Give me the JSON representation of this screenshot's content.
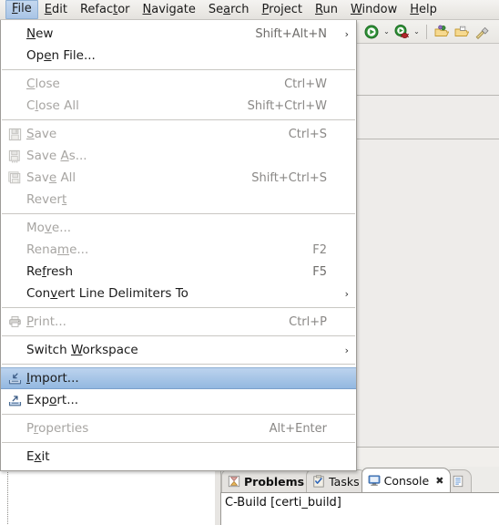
{
  "menubar": {
    "items": [
      {
        "label": "File",
        "mnemonic": "F",
        "open": true
      },
      {
        "label": "Edit",
        "mnemonic": "E",
        "open": false
      },
      {
        "label": "Refactor",
        "mnemonic": "t",
        "open": false
      },
      {
        "label": "Navigate",
        "mnemonic": "N",
        "open": false
      },
      {
        "label": "Search",
        "mnemonic": "a",
        "open": false
      },
      {
        "label": "Project",
        "mnemonic": "P",
        "open": false
      },
      {
        "label": "Run",
        "mnemonic": "R",
        "open": false
      },
      {
        "label": "Window",
        "mnemonic": "W",
        "open": false
      },
      {
        "label": "Help",
        "mnemonic": "H",
        "open": false
      }
    ]
  },
  "toolbar": {
    "buttons": [
      {
        "name": "run-button",
        "icon": "run-icon",
        "has_dropdown": true
      },
      {
        "name": "debug-button",
        "icon": "debug-icon",
        "has_dropdown": true
      },
      {
        "name": "separator",
        "icon": "separator",
        "has_dropdown": false
      },
      {
        "name": "new-c-project-button",
        "icon": "open-folder-color-icon",
        "has_dropdown": false
      },
      {
        "name": "open-folder-button",
        "icon": "open-folder-icon",
        "has_dropdown": false
      },
      {
        "name": "build-button",
        "icon": "hammer-icon",
        "has_dropdown": false
      }
    ],
    "dropdown_glyph": "⌄"
  },
  "file_menu": {
    "title": "File",
    "submenu_arrow": "›",
    "items": [
      {
        "label": "New",
        "mnemonic": "N",
        "accel": "Shift+Alt+N",
        "submenu": true,
        "disabled": false,
        "icon": null,
        "selected": false
      },
      {
        "label": "Open File...",
        "mnemonic": "e",
        "accel": "",
        "submenu": false,
        "disabled": false,
        "icon": null,
        "selected": false
      },
      {
        "separator": true
      },
      {
        "label": "Close",
        "mnemonic": "C",
        "accel": "Ctrl+W",
        "submenu": false,
        "disabled": true,
        "icon": null,
        "selected": false
      },
      {
        "label": "Close All",
        "mnemonic": "l",
        "accel": "Shift+Ctrl+W",
        "submenu": false,
        "disabled": true,
        "icon": null,
        "selected": false
      },
      {
        "separator": true
      },
      {
        "label": "Save",
        "mnemonic": "S",
        "accel": "Ctrl+S",
        "submenu": false,
        "disabled": true,
        "icon": "save-icon",
        "selected": false
      },
      {
        "label": "Save As...",
        "mnemonic": "A",
        "accel": "",
        "submenu": false,
        "disabled": true,
        "icon": "save-as-icon",
        "selected": false
      },
      {
        "label": "Save All",
        "mnemonic": "e",
        "accel": "Shift+Ctrl+S",
        "submenu": false,
        "disabled": true,
        "icon": "save-all-icon",
        "selected": false
      },
      {
        "label": "Revert",
        "mnemonic": "t",
        "accel": "",
        "submenu": false,
        "disabled": true,
        "icon": null,
        "selected": false
      },
      {
        "separator": true
      },
      {
        "label": "Move...",
        "mnemonic": "v",
        "accel": "",
        "submenu": false,
        "disabled": true,
        "icon": null,
        "selected": false
      },
      {
        "label": "Rename...",
        "mnemonic": "m",
        "accel": "F2",
        "submenu": false,
        "disabled": true,
        "icon": null,
        "selected": false
      },
      {
        "label": "Refresh",
        "mnemonic": "f",
        "accel": "F5",
        "submenu": false,
        "disabled": false,
        "icon": null,
        "selected": false
      },
      {
        "label": "Convert Line Delimiters To",
        "mnemonic": "v",
        "accel": "",
        "submenu": true,
        "disabled": false,
        "icon": null,
        "selected": false
      },
      {
        "separator": true
      },
      {
        "label": "Print...",
        "mnemonic": "P",
        "accel": "Ctrl+P",
        "submenu": false,
        "disabled": true,
        "icon": "print-icon",
        "selected": false
      },
      {
        "separator": true
      },
      {
        "label": "Switch Workspace",
        "mnemonic": "W",
        "accel": "",
        "submenu": true,
        "disabled": false,
        "icon": null,
        "selected": false
      },
      {
        "separator": true
      },
      {
        "label": "Import...",
        "mnemonic": "I",
        "accel": "",
        "submenu": false,
        "disabled": false,
        "icon": "import-icon",
        "selected": true
      },
      {
        "label": "Export...",
        "mnemonic": "o",
        "accel": "",
        "submenu": false,
        "disabled": false,
        "icon": "export-icon",
        "selected": false
      },
      {
        "separator": true
      },
      {
        "label": "Properties",
        "mnemonic": "r",
        "accel": "Alt+Enter",
        "submenu": false,
        "disabled": true,
        "icon": null,
        "selected": false
      },
      {
        "separator": true
      },
      {
        "label": "Exit",
        "mnemonic": "x",
        "accel": "",
        "submenu": false,
        "disabled": false,
        "icon": null,
        "selected": false
      }
    ]
  },
  "bottom_panel": {
    "tabs": [
      {
        "label": "Problems",
        "icon": "problems-icon",
        "active": false,
        "bold": true,
        "closable": false
      },
      {
        "label": "Tasks",
        "icon": "tasks-icon",
        "active": false,
        "bold": false,
        "closable": false
      },
      {
        "label": "Console",
        "icon": "console-icon",
        "active": true,
        "bold": false,
        "closable": true
      },
      {
        "label": "",
        "icon": "properties-view-icon",
        "active": false,
        "bold": false,
        "closable": false
      }
    ],
    "close_glyph": "✖",
    "console_title": "C-Build [certi_build]"
  },
  "colors": {
    "selection_blue_top": "#bcd3ee",
    "selection_blue_bottom": "#93b8e0",
    "menubar_bg": "#eceae6",
    "menu_bg": "#ffffff",
    "disabled_text": "#a7a5a2",
    "accel_text": "#8a8886",
    "panel_bg": "#edece9"
  }
}
